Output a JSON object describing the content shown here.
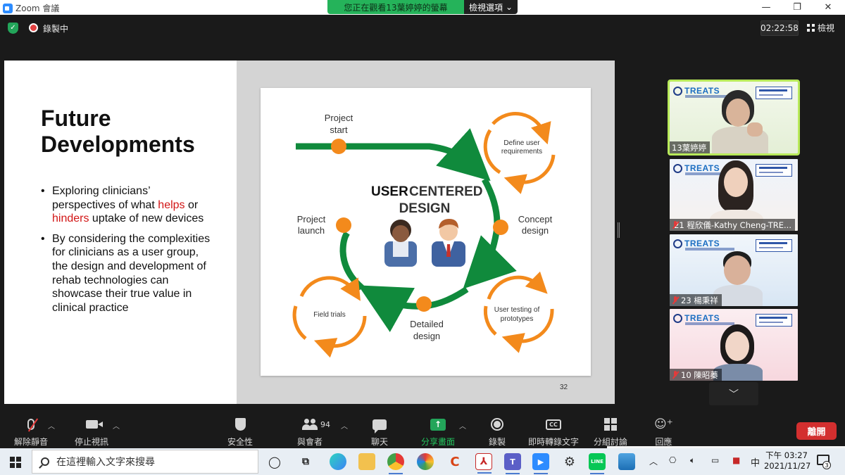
{
  "window": {
    "title": "Zoom 會議",
    "share_banner": "您正在觀看13葉婷婷的螢幕",
    "view_options": "檢視選項",
    "controls": [
      "—",
      "❐",
      "✕"
    ]
  },
  "infobar": {
    "recording": "錄製中",
    "timer": "02:22:58",
    "view_label": "檢視"
  },
  "slide": {
    "title": "Future Developments",
    "bullet1_pre": "Exploring clinicians’ perspectives of what ",
    "bullet1_helps": "helps",
    "bullet1_or": " or ",
    "bullet1_hinders": "hinders",
    "bullet1_post": " uptake of new devices",
    "bullet2": "By considering the complexities for clinicians as a user group, the design and development of rehab technologies can showcase their true value in clinical practice",
    "page_number": "32",
    "diagram": {
      "title_user": "USER",
      "title_centered": "CENTERED",
      "title_design": "DESIGN",
      "project_start": [
        "Project",
        "start"
      ],
      "concept_design": [
        "Concept",
        "design"
      ],
      "detailed_design": [
        "Detailed",
        "design"
      ],
      "project_launch": [
        "Project",
        "launch"
      ],
      "define_user": [
        "Define user",
        "requirements"
      ],
      "user_testing": [
        "User testing of",
        "prototypes"
      ],
      "field_trials": "Field trials",
      "colors": {
        "green": "#108a3c",
        "orange": "#f38a1c"
      }
    }
  },
  "participants": [
    {
      "name": "13葉婷婷",
      "muted": false,
      "active": true,
      "logo": "TREATS"
    },
    {
      "name": "21 程欣儀-Kathy Cheng-TRE...",
      "muted": true,
      "active": false,
      "logo": "TREATS"
    },
    {
      "name": "23 楊秉祥",
      "muted": true,
      "active": false,
      "logo": "TREATS"
    },
    {
      "name": "10 陳昭蓁",
      "muted": true,
      "active": false,
      "logo": "TREATS"
    }
  ],
  "toolbar": {
    "unmute": "解除靜音",
    "stop_video": "停止視訊",
    "security": "安全性",
    "participants": "與會者",
    "participant_count": "94",
    "chat": "聊天",
    "share_screen": "分享畫面",
    "record": "錄製",
    "live_transcript": "即時轉錄文字",
    "breakout": "分組討論",
    "reactions": "回應",
    "leave": "離開",
    "cc": "CC"
  },
  "taskbar": {
    "search_placeholder": "在這裡輸入文字來搜尋",
    "ime": "中",
    "time": "下午 03:27",
    "date": "2021/11/27",
    "notification_count": "3"
  }
}
